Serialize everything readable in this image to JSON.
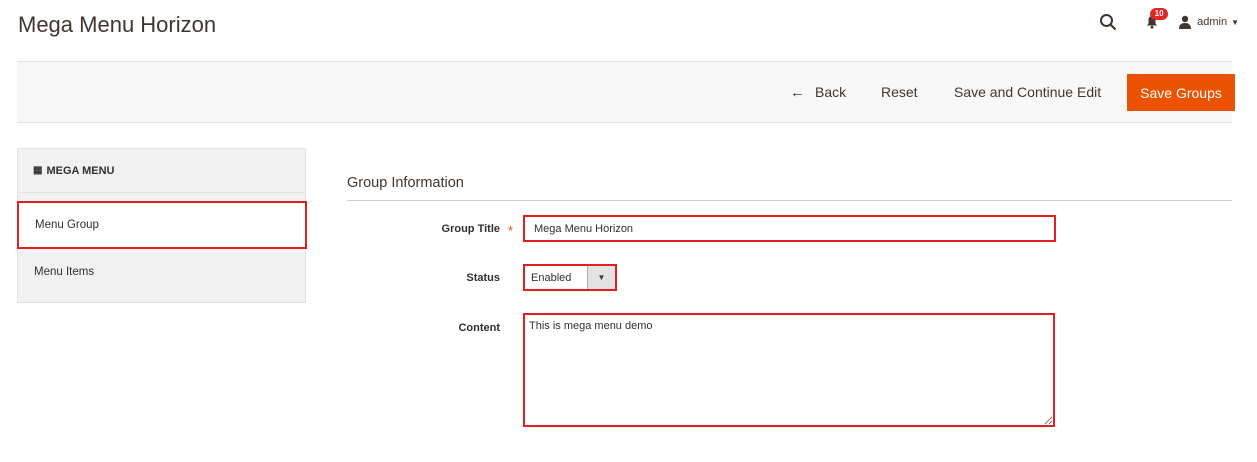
{
  "header": {
    "title": "Mega Menu Horizon",
    "notification_count": "10",
    "user_name": "admin",
    "icons": {
      "search": "search-icon",
      "notifications": "bell-icon",
      "user": "user-icon"
    }
  },
  "actions": {
    "back": "Back",
    "reset": "Reset",
    "save_continue": "Save and Continue Edit",
    "save_groups": "Save Groups"
  },
  "sidebar": {
    "title": "MEGA MENU",
    "items": [
      {
        "label": "Menu Group",
        "active": true
      },
      {
        "label": "Menu Items",
        "active": false
      }
    ]
  },
  "form": {
    "section_title": "Group Information",
    "group_title": {
      "label": "Group Title",
      "value": "Mega Menu Horizon"
    },
    "status": {
      "label": "Status",
      "value": "Enabled"
    },
    "content": {
      "label": "Content",
      "value": "This is mega menu demo"
    }
  },
  "colors": {
    "accent": "#eb5202",
    "highlight": "#e02020",
    "badge": "#e22626"
  }
}
